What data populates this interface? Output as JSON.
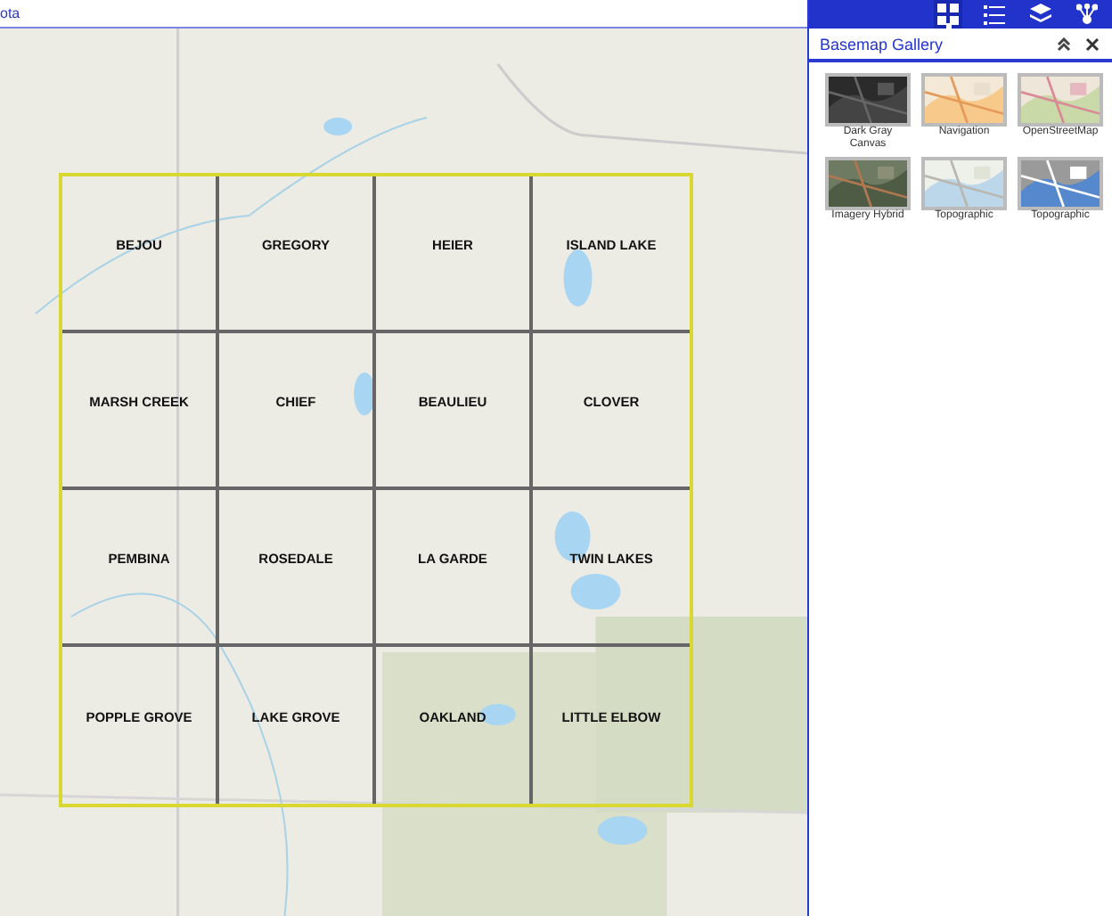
{
  "top_bar": {
    "title": "ota"
  },
  "panel_tabs": [
    {
      "kind": "grid",
      "selected": true
    },
    {
      "kind": "list",
      "selected": false
    },
    {
      "kind": "layers",
      "selected": false
    },
    {
      "kind": "share",
      "selected": false
    }
  ],
  "panel": {
    "title": "Basemap Gallery"
  },
  "basemaps": [
    {
      "label": "Dark Gray Canvas"
    },
    {
      "label": "Navigation"
    },
    {
      "label": "OpenStreetMap"
    },
    {
      "label": "Imagery Hybrid"
    },
    {
      "label": "Topographic"
    },
    {
      "label": "Topographic"
    }
  ],
  "townships": [
    [
      "BEJOU",
      "GREGORY",
      "HEIER",
      "ISLAND LAKE"
    ],
    [
      "MARSH CREEK",
      "CHIEF",
      "BEAULIEU",
      "CLOVER"
    ],
    [
      "PEMBINA",
      "ROSEDALE",
      "LA GARDE",
      "TWIN LAKES"
    ],
    [
      "POPPLE GROVE",
      "LAKE GROVE",
      "OAKLAND",
      "LITTLE ELBOW"
    ]
  ]
}
